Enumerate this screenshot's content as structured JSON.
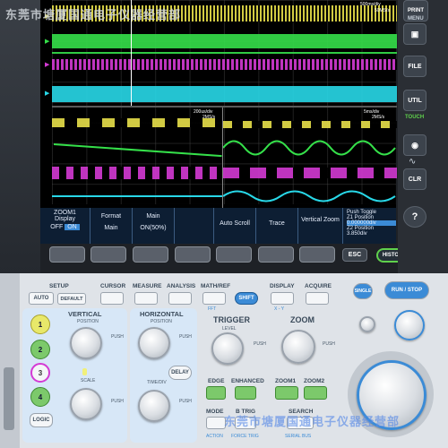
{
  "watermark_top": "东莞市塘厦国通电子仪器经营部",
  "watermark_bottom": "东莞市塘厦国通电子仪器经营部",
  "screen": {
    "top_timebase": "500ms/div",
    "top_rate": "50MS/s",
    "zoom1_timebase": "200us/div",
    "zoom1_rate": "2MS/s",
    "zoom2_timebase": "5ms/div",
    "zoom2_rate": "2MS/s"
  },
  "menu": [
    {
      "title": "ZOOM1\nDisplay",
      "value_off": "OFF",
      "value_on": "ON"
    },
    {
      "title": "Format",
      "value": "Main"
    },
    {
      "title": "Main",
      "value": "ON(50%)"
    },
    {
      "title": "",
      "value": ""
    },
    {
      "title": "Auto Scroll",
      "value": ""
    },
    {
      "title": "Trace",
      "value": ""
    },
    {
      "title": "Vertical Zoom",
      "value": ""
    }
  ],
  "push_toggle": {
    "label": "Push Toggle",
    "z1_position_label": "Z1 Position",
    "z1_position_value": "0.000000div",
    "z2_position_label": "Z2 Position",
    "z2_position_value": "3.850div"
  },
  "right_panel": {
    "print": "PRINT",
    "menu": "MENU",
    "file": "FILE",
    "util": "UTIL",
    "touch": "TOUCH",
    "clr": "CLR",
    "help": "?"
  },
  "bottom_keys": {
    "esc": "ESC",
    "history": "HISTORY"
  },
  "front": {
    "setup": "SETUP",
    "auto": "AUTO",
    "default": "DEFAULT",
    "cursor": "CURSOR",
    "measure": "MEASURE",
    "analysis": "ANALYSIS",
    "math_ref": "MATH/REF",
    "fft": "FFT",
    "shift": "SHIFT",
    "display": "DISPLAY",
    "xy": "X - Y",
    "acquire": "ACQUIRE",
    "single": "SINGLE",
    "run_stop": "RUN / STOP",
    "vertical": "VERTICAL",
    "position": "POSITION",
    "push_fine": "PUSH",
    "scale": "SCALE",
    "horizontal": "HORIZONTAL",
    "delay": "DELAY",
    "time_div": "TIME/DIV",
    "trigger": "TRIGGER",
    "level": "LEVEL",
    "zoom": "ZOOM",
    "edge": "EDGE",
    "enhanced": "ENHANCED",
    "zoom1": "ZOOM1",
    "zoom2": "ZOOM2",
    "mode": "MODE",
    "b_trig": "B TRIG",
    "search": "SEARCH",
    "action": "ACTION",
    "force_trig": "FORCE TRIG",
    "serial_bus": "SERIAL BUS",
    "logic": "LOGIC",
    "ch1": "1",
    "ch2": "2",
    "ch3": "3",
    "ch4": "4"
  },
  "colors": {
    "ch1": "#e8e04a",
    "ch2": "#35e04a",
    "ch3": "#d43ad4",
    "ch4": "#28d8e8",
    "accent_blue": "#3b8bd6",
    "history_green": "#5fd14c"
  }
}
